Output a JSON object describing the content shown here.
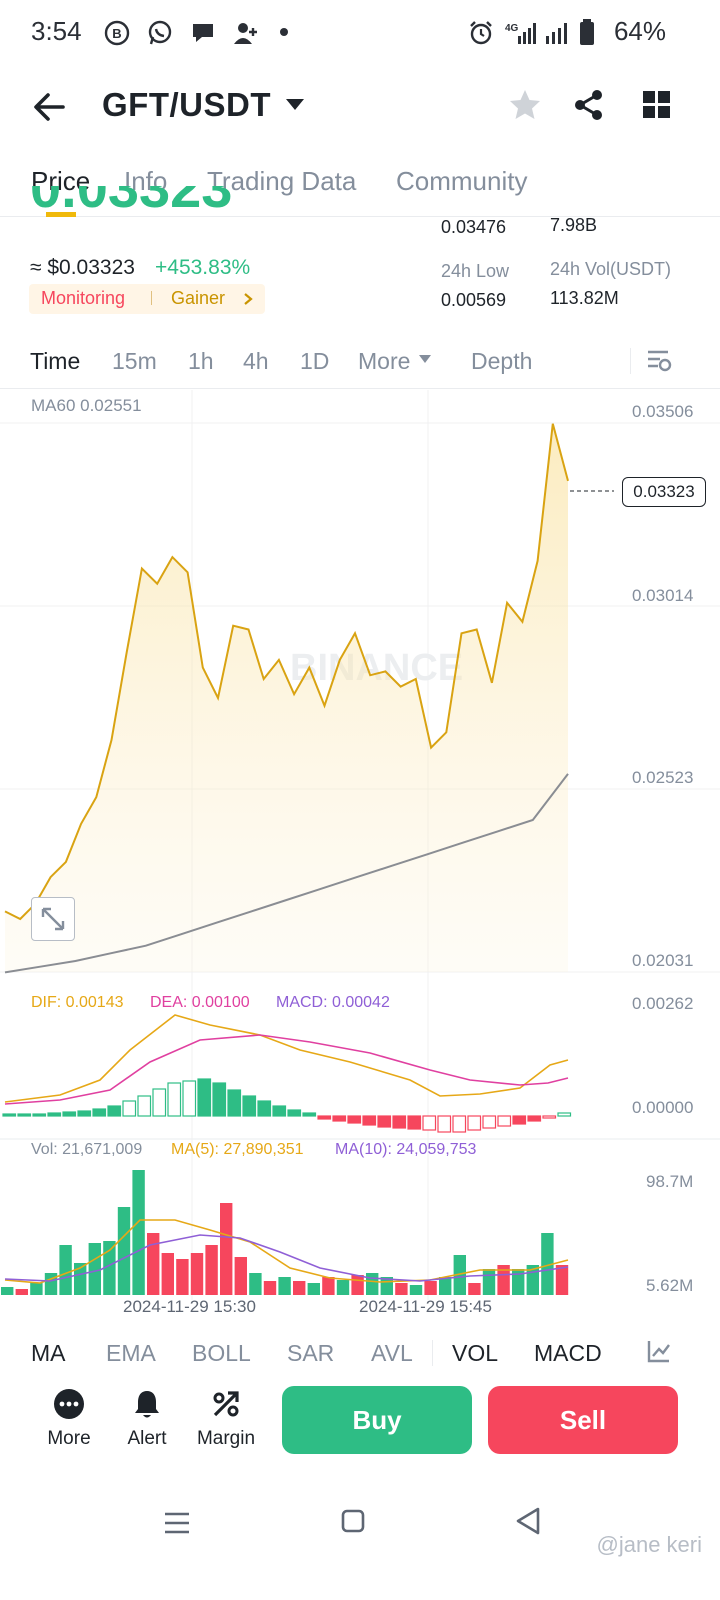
{
  "status_bar": {
    "time": "3:54",
    "battery": "64%",
    "icons": [
      "b-circle-icon",
      "whatsapp-icon",
      "chat-bubble-icon",
      "add-person-icon",
      "dot-icon",
      "alarm-icon",
      "4g-signal-icon",
      "signal-icon",
      "battery-icon"
    ]
  },
  "header": {
    "pair": "GFT/USDT",
    "icons": [
      "back-arrow-icon",
      "dropdown-caret-icon",
      "star-icon",
      "share-icon",
      "grid-icon"
    ]
  },
  "tabs": [
    {
      "label": "Price",
      "active": true
    },
    {
      "label": "Info",
      "active": false
    },
    {
      "label": "Trading Data",
      "active": false
    },
    {
      "label": "Community",
      "active": false
    }
  ],
  "price": {
    "last": "0.03323",
    "usd": "≈ $0.03323",
    "change": "+453.83%",
    "tag_monitoring": "Monitoring",
    "tag_gainer": "Gainer",
    "stats": {
      "high_val": "0.03476",
      "vol_gft_val": "7.98B",
      "low_label": "24h Low",
      "low_val": "0.00569",
      "vol_usdt_label": "24h Vol(USDT)",
      "vol_usdt_val": "113.82M"
    }
  },
  "intervals": [
    {
      "label": "Time",
      "active": true
    },
    {
      "label": "15m",
      "active": false
    },
    {
      "label": "1h",
      "active": false
    },
    {
      "label": "4h",
      "active": false
    },
    {
      "label": "1D",
      "active": false
    },
    {
      "label": "More",
      "active": false
    },
    {
      "label": "Depth",
      "active": false
    }
  ],
  "chart": {
    "ma_label": "MA60 0.02551",
    "y_ticks": [
      "0.03506",
      "0.03014",
      "0.02523",
      "0.02031"
    ],
    "current_price_tag": "0.03323",
    "watermark": "BINANCE",
    "macd": {
      "dif": "DIF: 0.00143",
      "dea": "DEA: 0.00100",
      "macd": "MACD: 0.00042",
      "y_top": "0.00262",
      "y_zero": "0.00000"
    },
    "volume": {
      "vol": "Vol: 21,671,009",
      "ma5": "MA(5): 27,890,351",
      "ma10": "MA(10): 24,059,753",
      "y_top": "98.7M",
      "y_bottom": "5.62M"
    },
    "x_labels": [
      "2024-11-29 15:30",
      "2024-11-29 15:45"
    ],
    "colors": {
      "up": "#2ebd85",
      "down": "#f6465d",
      "price_line": "#d9a312",
      "ma60": "#8a8d93",
      "dif": "#e6a817",
      "dea": "#e040a0",
      "ma10": "#8f5fd6"
    }
  },
  "chart_data": {
    "type": "line",
    "x_range": [
      "2024-11-29 15:30",
      "2024-11-29 15:45"
    ],
    "ylim": [
      0.02031,
      0.03506
    ],
    "series": [
      {
        "values": [
          0.0219,
          0.0217,
          0.0221,
          0.0228,
          0.0232,
          0.0242,
          0.0249,
          0.0264,
          0.0287,
          0.0309,
          0.0305,
          0.0312,
          0.0308,
          0.0283,
          0.0275,
          0.0294,
          0.0293,
          0.028,
          0.0285,
          0.0276,
          0.0283,
          0.0273,
          0.0285,
          0.0292,
          0.0281,
          0.0282,
          0.0278,
          0.028,
          0.0262,
          0.0266,
          0.0292,
          0.0293,
          0.0279,
          0.03,
          0.0295,
          0.0311,
          0.0347,
          0.0332
        ]
      },
      {
        "values": [
          0.0203,
          0.02045,
          0.0206,
          0.0208,
          0.021,
          0.0213,
          0.0216,
          0.0219,
          0.0222,
          0.0225,
          0.0228,
          0.0231,
          0.0234,
          0.0237,
          0.024,
          0.0243,
          0.02551
        ]
      }
    ]
  },
  "bottom_indicators": [
    {
      "label": "MA",
      "active": true
    },
    {
      "label": "EMA",
      "active": false
    },
    {
      "label": "BOLL",
      "active": false
    },
    {
      "label": "SAR",
      "active": false
    },
    {
      "label": "AVL",
      "active": false
    },
    {
      "label": "VOL",
      "active": true
    },
    {
      "label": "MACD",
      "active": true
    }
  ],
  "actions": [
    {
      "label": "More",
      "icon": "more-dots-icon"
    },
    {
      "label": "Alert",
      "icon": "bell-icon"
    },
    {
      "label": "Margin",
      "icon": "margin-percent-icon"
    }
  ],
  "buy_label": "Buy",
  "sell_label": "Sell",
  "watermark": "@jane keri"
}
